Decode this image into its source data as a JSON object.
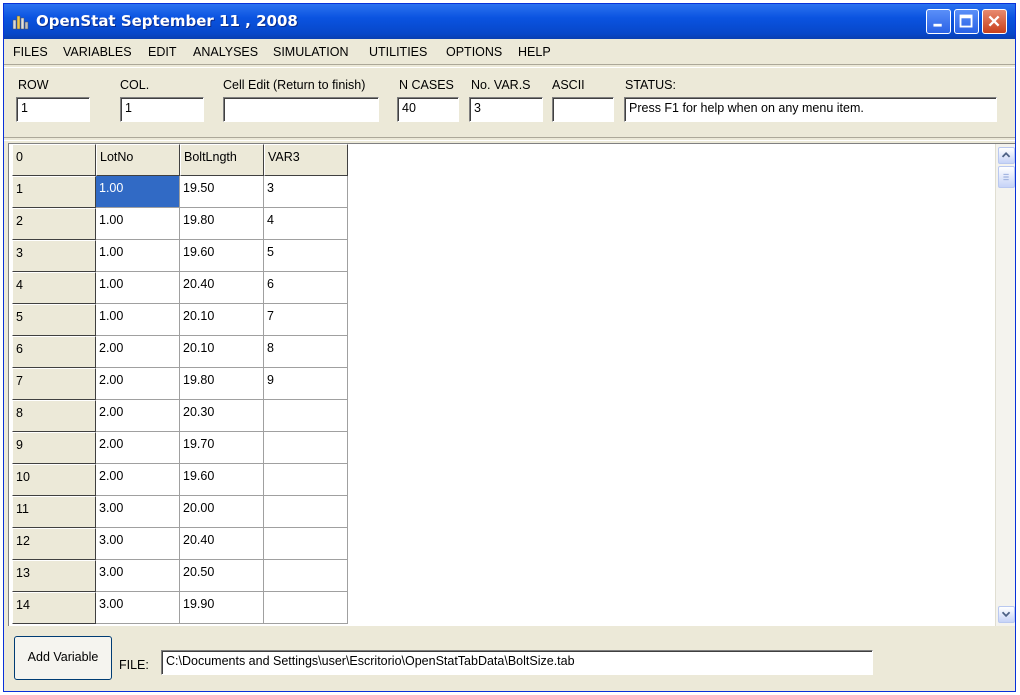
{
  "window": {
    "title": "OpenStat September 11 , 2008"
  },
  "menu": [
    "FILES",
    "VARIABLES",
    "EDIT",
    "ANALYSES",
    "SIMULATION",
    "UTILITIES",
    "OPTIONS",
    "HELP"
  ],
  "fields": {
    "row": {
      "label": "ROW",
      "value": "1"
    },
    "col": {
      "label": "COL.",
      "value": "1"
    },
    "cell_edit": {
      "label": "Cell Edit (Return to finish)",
      "value": ""
    },
    "n_cases": {
      "label": "N CASES",
      "value": "40"
    },
    "no_vars": {
      "label": "No. VAR.S",
      "value": "3"
    },
    "ascii": {
      "label": "ASCII",
      "value": ""
    },
    "status": {
      "label": "STATUS:",
      "value": "Press F1 for help when on any menu item."
    }
  },
  "grid": {
    "corner": "0",
    "columns": [
      "LotNo",
      "BoltLngth",
      "VAR3"
    ],
    "rows": [
      {
        "num": "1",
        "cells": [
          "1.00",
          "19.50",
          "3"
        ]
      },
      {
        "num": "2",
        "cells": [
          "1.00",
          "19.80",
          "4"
        ]
      },
      {
        "num": "3",
        "cells": [
          "1.00",
          "19.60",
          "5"
        ]
      },
      {
        "num": "4",
        "cells": [
          "1.00",
          "20.40",
          "6"
        ]
      },
      {
        "num": "5",
        "cells": [
          "1.00",
          "20.10",
          "7"
        ]
      },
      {
        "num": "6",
        "cells": [
          "2.00",
          "20.10",
          "8"
        ]
      },
      {
        "num": "7",
        "cells": [
          "2.00",
          "19.80",
          "9"
        ]
      },
      {
        "num": "8",
        "cells": [
          "2.00",
          "20.30",
          ""
        ]
      },
      {
        "num": "9",
        "cells": [
          "2.00",
          "19.70",
          ""
        ]
      },
      {
        "num": "10",
        "cells": [
          "2.00",
          "19.60",
          ""
        ]
      },
      {
        "num": "11",
        "cells": [
          "3.00",
          "20.00",
          ""
        ]
      },
      {
        "num": "12",
        "cells": [
          "3.00",
          "20.40",
          ""
        ]
      },
      {
        "num": "13",
        "cells": [
          "3.00",
          "20.50",
          ""
        ]
      },
      {
        "num": "14",
        "cells": [
          "3.00",
          "19.90",
          ""
        ]
      }
    ],
    "selected": {
      "row": 0,
      "col": 0
    }
  },
  "bottom": {
    "add_variable": "Add Variable",
    "file_label": "FILE:",
    "file_path": "C:\\Documents and Settings\\user\\Escritorio\\OpenStatTabData\\BoltSize.tab"
  },
  "icons": {
    "app": "app-chart-icon",
    "minimize": "minimize-icon",
    "maximize": "maximize-icon",
    "close": "close-icon",
    "scroll_up": "scroll-up-icon",
    "scroll_down": "scroll-down-icon"
  },
  "colors": {
    "titlebar": "#0a53e0",
    "selection": "#316ac5",
    "face": "#ece9d8"
  }
}
